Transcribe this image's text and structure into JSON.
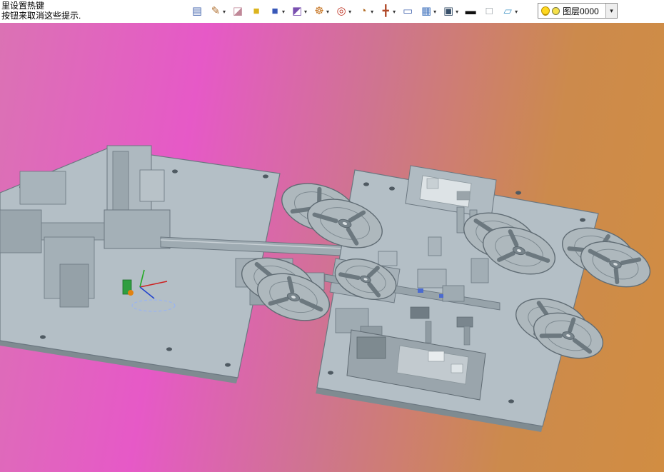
{
  "topbar": {
    "hints": {
      "line1": "里设置热键",
      "line2": "按钮来取消这些提示."
    },
    "toolbar": {
      "dropdown_glyph": "▾",
      "icons": [
        {
          "name": "sheet-icon",
          "glyph": "▤",
          "color": "#4a6ab0",
          "dropdown": false
        },
        {
          "name": "color-pencil-icon",
          "glyph": "✎",
          "color": "#b07030",
          "dropdown": true
        },
        {
          "name": "eraser-icon",
          "glyph": "◪",
          "color": "#c08898",
          "dropdown": false
        },
        {
          "name": "yellow-box-icon",
          "glyph": "■",
          "color": "#dcb41e",
          "dropdown": false
        },
        {
          "name": "blue-box-icon",
          "glyph": "■",
          "color": "#3858b8",
          "dropdown": true
        },
        {
          "name": "material-icon",
          "glyph": "◩",
          "color": "#7a50b0",
          "dropdown": true
        },
        {
          "name": "color-wheel-icon",
          "glyph": "☸",
          "color": "#c87828",
          "dropdown": true
        },
        {
          "name": "compass-icon",
          "glyph": "◎",
          "color": "#c03828",
          "dropdown": true
        },
        {
          "name": "zoom-icon",
          "glyph": "◔",
          "color": "#b06820",
          "dropdown": true
        },
        {
          "name": "move-icon",
          "glyph": "╋",
          "color": "#b04828",
          "dropdown": true
        },
        {
          "name": "selection-box-icon",
          "glyph": "▭",
          "color": "#4868b0",
          "dropdown": false
        },
        {
          "name": "grid-icon",
          "glyph": "▦",
          "color": "#4878c0",
          "dropdown": true
        },
        {
          "name": "display-icon",
          "glyph": "▣",
          "color": "#38506a",
          "dropdown": true
        },
        {
          "name": "line-weight-icon",
          "glyph": "▬",
          "color": "#101010",
          "dropdown": false
        },
        {
          "name": "white-square-icon",
          "glyph": "□",
          "color": "#8a9298",
          "dropdown": false
        },
        {
          "name": "panel-icon",
          "glyph": "▱",
          "color": "#4898c8",
          "dropdown": true
        }
      ]
    },
    "layer_control": {
      "label": "图层0000",
      "dropdown_glyph": "▾"
    }
  },
  "viewport": {
    "gradient": {
      "c1": "#db72b4",
      "c2": "#e659c7",
      "c3": "#cf7490",
      "c4": "#cc8a4c",
      "c5": "#d18d42"
    },
    "model_gray": "#b4bfc6",
    "model_edge": "#6b7780",
    "axis_colors": {
      "x": "#cc2222",
      "y": "#22aa22",
      "z": "#2244cc"
    }
  }
}
